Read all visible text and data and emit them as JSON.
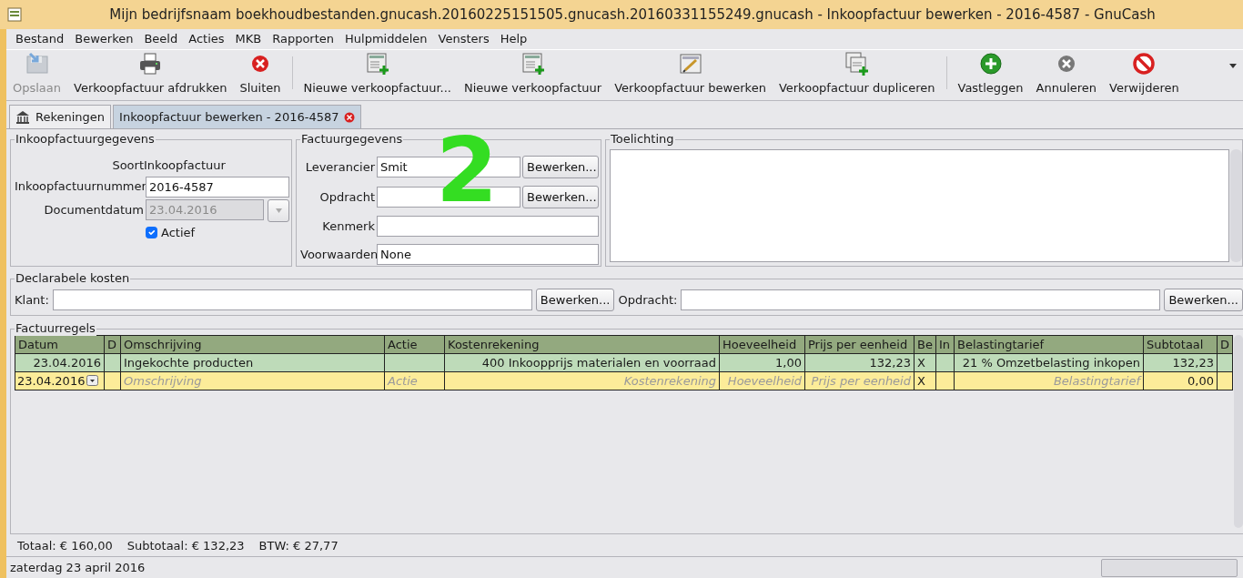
{
  "window": {
    "title": "Mijn bedrijfsnaam boekhoudbestanden.gnucash.20160225151505.gnucash.20160331155249.gnucash - Inkoopfactuur bewerken - 2016-4587 - GnuCash"
  },
  "menu": [
    "Bestand",
    "Bewerken",
    "Beeld",
    "Acties",
    "MKB",
    "Rapporten",
    "Hulpmiddelen",
    "Vensters",
    "Help"
  ],
  "toolbar": [
    [
      {
        "label": "Opslaan",
        "disabled": true
      },
      {
        "label": "Verkoopfactuur afdrukken",
        "disabled": false
      },
      {
        "label": "Sluiten",
        "disabled": false
      }
    ],
    [
      {
        "label": "Nieuwe verkoopfactuur...",
        "disabled": false
      },
      {
        "label": "Nieuwe verkoopfactuur",
        "disabled": false
      },
      {
        "label": "Verkoopfactuur bewerken",
        "disabled": false
      },
      {
        "label": "Verkoopfactuur dupliceren",
        "disabled": false
      }
    ],
    [
      {
        "label": "Vastleggen",
        "disabled": false
      },
      {
        "label": "Annuleren",
        "disabled": false
      },
      {
        "label": "Verwijderen",
        "disabled": false
      }
    ]
  ],
  "tabs": [
    {
      "label": "Rekeningen",
      "selected": false,
      "closable": false
    },
    {
      "label": "Inkoopfactuur bewerken - 2016-4587",
      "selected": true,
      "closable": true
    }
  ],
  "invoice_info": {
    "title": "Inkoopfactuurgegevens",
    "type_label": "Soort",
    "type_value": "Inkoopfactuur",
    "number_label": "Inkoopfactuurnummer",
    "number_value": "2016-4587",
    "date_label": "Documentdatum",
    "date_value": "23.04.2016",
    "date_disabled": true,
    "active_label": "Actief",
    "active_checked": true
  },
  "billing": {
    "title": "Factuurgegevens",
    "fields": [
      {
        "label": "Leverancier",
        "value": "Smit",
        "button": "Bewerken..."
      },
      {
        "label": "Opdracht",
        "button": "Bewerken..."
      },
      {
        "label": "Kenmerk"
      },
      {
        "label": "Voorwaarden",
        "value": "None"
      }
    ]
  },
  "notes": {
    "title": "Toelichting"
  },
  "billable": {
    "title": "Declarabele kosten",
    "customer_label": "Klant:",
    "customer_button": "Bewerken...",
    "job_label": "Opdracht:",
    "job_button": "Bewerken..."
  },
  "lines": {
    "title": "Factuurregels",
    "columns": [
      "Datum",
      "D",
      "Omschrijving",
      "Actie",
      "Kostenrekening",
      "Hoeveelheid",
      "Prijs per eenheid",
      "Be",
      "In",
      "Belastingtarief",
      "Subtotaal",
      "D"
    ],
    "rows": [
      {
        "selected": false,
        "cells": [
          {
            "text": "23.04.2016"
          },
          null,
          {
            "text": "Ingekochte producten"
          },
          null,
          {
            "text": "400 Inkoopprijs materialen en voorraad"
          },
          {
            "text": "1,00"
          },
          {
            "text": "132,23"
          },
          {
            "text": "X"
          },
          null,
          {
            "text": "21 % Omzetbelasting inkopen"
          },
          {
            "text": "132,23"
          },
          null
        ]
      },
      {
        "selected": true,
        "cells": [
          {
            "text": "23.04.2016"
          },
          null,
          {
            "placeholder": "Omschrijving"
          },
          {
            "placeholder": "Actie"
          },
          {
            "placeholder": "Kostenrekening"
          },
          {
            "placeholder": "Hoeveelheid"
          },
          {
            "placeholder": "Prijs per eenheid"
          },
          {
            "text": "X"
          },
          null,
          {
            "placeholder": "Belastingtarief"
          },
          {
            "text": "0,00"
          },
          null
        ]
      }
    ]
  },
  "totals": [
    "Totaal: € 160,00",
    "Subtotaal: € 132,23",
    "BTW: € 27,77"
  ],
  "status_bar": {
    "text": "zaterdag 23 april 2016"
  },
  "annotation": "2"
}
